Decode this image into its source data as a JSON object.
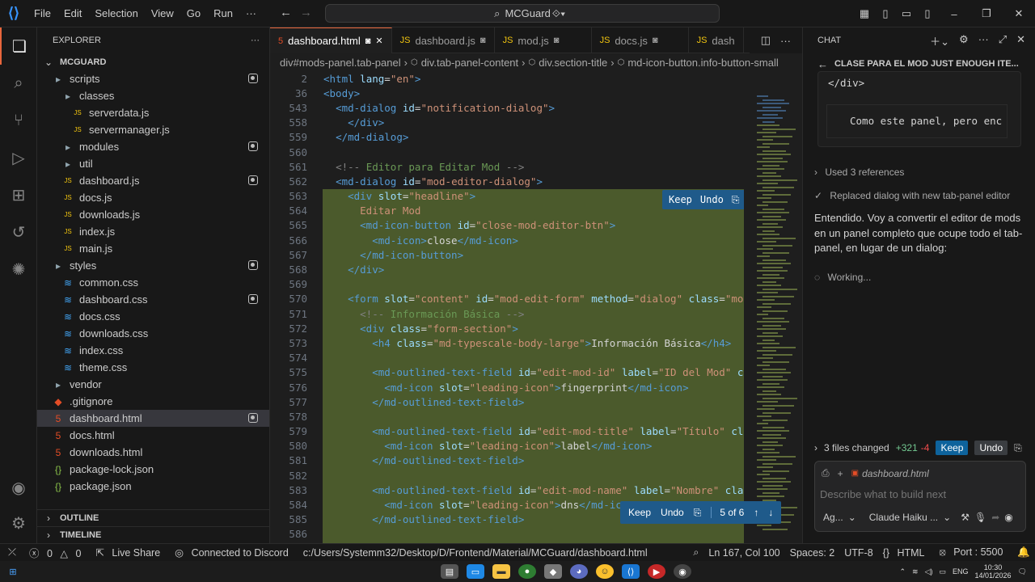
{
  "menu": [
    "File",
    "Edit",
    "Selection",
    "View",
    "Go",
    "Run",
    "···"
  ],
  "command_center": "MCGuard",
  "explorer": {
    "title": "EXPLORER",
    "root": "MCGUARD",
    "items": [
      {
        "name": "scripts",
        "kind": "folder",
        "depth": 1,
        "modified": true
      },
      {
        "name": "classes",
        "kind": "folder",
        "depth": 2,
        "modified": false
      },
      {
        "name": "serverdata.js",
        "kind": "js",
        "depth": 3,
        "modified": false
      },
      {
        "name": "servermanager.js",
        "kind": "js",
        "depth": 3,
        "modified": false
      },
      {
        "name": "modules",
        "kind": "folder",
        "depth": 2,
        "modified": true
      },
      {
        "name": "util",
        "kind": "folder",
        "depth": 2,
        "modified": false
      },
      {
        "name": "dashboard.js",
        "kind": "js",
        "depth": 2,
        "modified": true
      },
      {
        "name": "docs.js",
        "kind": "js",
        "depth": 2,
        "modified": false
      },
      {
        "name": "downloads.js",
        "kind": "js",
        "depth": 2,
        "modified": false
      },
      {
        "name": "index.js",
        "kind": "js",
        "depth": 2,
        "modified": false
      },
      {
        "name": "main.js",
        "kind": "js",
        "depth": 2,
        "modified": false
      },
      {
        "name": "styles",
        "kind": "folder",
        "depth": 1,
        "modified": true
      },
      {
        "name": "common.css",
        "kind": "css",
        "depth": 2,
        "modified": false
      },
      {
        "name": "dashboard.css",
        "kind": "css",
        "depth": 2,
        "modified": true
      },
      {
        "name": "docs.css",
        "kind": "css",
        "depth": 2,
        "modified": false
      },
      {
        "name": "downloads.css",
        "kind": "css",
        "depth": 2,
        "modified": false
      },
      {
        "name": "index.css",
        "kind": "css",
        "depth": 2,
        "modified": false
      },
      {
        "name": "theme.css",
        "kind": "css",
        "depth": 2,
        "modified": false
      },
      {
        "name": "vendor",
        "kind": "folder",
        "depth": 1,
        "modified": false
      },
      {
        "name": ".gitignore",
        "kind": "git",
        "depth": 1,
        "modified": false
      },
      {
        "name": "dashboard.html",
        "kind": "html",
        "depth": 1,
        "modified": true,
        "selected": true
      },
      {
        "name": "docs.html",
        "kind": "html",
        "depth": 1,
        "modified": false
      },
      {
        "name": "downloads.html",
        "kind": "html",
        "depth": 1,
        "modified": false
      },
      {
        "name": "package-lock.json",
        "kind": "json",
        "depth": 1,
        "modified": false
      },
      {
        "name": "package.json",
        "kind": "json",
        "depth": 1,
        "modified": false
      }
    ],
    "outline": "OUTLINE",
    "timeline": "TIMELINE"
  },
  "tabs": [
    {
      "label": "dashboard.html",
      "kind": "html",
      "active": true
    },
    {
      "label": "dashboard.js",
      "kind": "js",
      "active": false
    },
    {
      "label": "mod.js",
      "kind": "js",
      "active": false
    },
    {
      "label": "docs.js",
      "kind": "js",
      "active": false
    },
    {
      "label": "dash",
      "kind": "js",
      "active": false
    }
  ],
  "breadcrumbs": [
    "div#mods-panel.tab-panel",
    "div.tab-panel-content",
    "div.section-title",
    "md-icon-button.info-button-small"
  ],
  "code_lines": [
    {
      "n": "2",
      "h": "<span class=tg>&lt;html</span> <span class=at>lang</span>=<span class=st>\"en\"</span><span class=tg>&gt;</span>",
      "i": 0
    },
    {
      "n": "36",
      "h": "<span class=tg>&lt;body&gt;</span>",
      "i": 0
    },
    {
      "n": "543",
      "h": "  <span class=tg>&lt;md-dialog</span> <span class=at>id</span>=<span class=st>\"notification-dialog\"</span><span class=tg>&gt;</span>",
      "i": 0
    },
    {
      "n": "558",
      "h": "    <span class=tg>&lt;/div&gt;</span>",
      "i": 0
    },
    {
      "n": "559",
      "h": "  <span class=tg>&lt;/md-dialog&gt;</span>",
      "i": 0
    },
    {
      "n": "560",
      "h": "",
      "i": 1
    },
    {
      "n": "561",
      "h": "  <span class=tgy>&lt;!--</span> <span class=cm>Editor para Editar Mod</span> <span class=tgy>--&gt;</span>",
      "i": 1
    },
    {
      "n": "562",
      "h": "  <span class=tg>&lt;md-dialog</span> <span class=at>id</span>=<span class=st>\"mod-editor-dialog\"</span><span class=tg>&gt;</span>",
      "i": 1
    },
    {
      "n": "563",
      "h": "    <span class=tg>&lt;div</span> <span class=at>slot</span>=<span class=st>\"headline\"</span><span class=tg>&gt;</span>",
      "i": 1
    },
    {
      "n": "564",
      "h": "      <span class=st>Editar Mod</span>",
      "i": 1
    },
    {
      "n": "565",
      "h": "      <span class=tg>&lt;md-icon-button</span> <span class=at>id</span>=<span class=st>\"close-mod-editor-btn\"</span><span class=tg>&gt;</span>",
      "i": 1
    },
    {
      "n": "566",
      "h": "        <span class=tg>&lt;md-icon&gt;</span><span class=tx>close</span><span class=tg>&lt;/md-icon&gt;</span>",
      "i": 1
    },
    {
      "n": "567",
      "h": "      <span class=tg>&lt;/md-icon-button&gt;</span>",
      "i": 1
    },
    {
      "n": "568",
      "h": "    <span class=tg>&lt;/div&gt;</span>",
      "i": 1
    },
    {
      "n": "569",
      "h": "",
      "i": 1
    },
    {
      "n": "570",
      "h": "    <span class=tg>&lt;form</span> <span class=at>slot</span>=<span class=st>\"content\"</span> <span class=at>id</span>=<span class=st>\"mod-edit-form\"</span> <span class=at>method</span>=<span class=st>\"dialog\"</span> <span class=at>class</span>=<span class=st>\"mod-</span>",
      "i": 1
    },
    {
      "n": "571",
      "h": "      <span class=tgy>&lt;!--</span> <span class=cm>Información Básica</span> <span class=tgy>--&gt;</span>",
      "i": 1
    },
    {
      "n": "572",
      "h": "      <span class=tg>&lt;div</span> <span class=at>class</span>=<span class=st>\"form-section\"</span><span class=tg>&gt;</span>",
      "i": 1
    },
    {
      "n": "573",
      "h": "        <span class=tg>&lt;h4</span> <span class=at>class</span>=<span class=st>\"md-typescale-body-large\"</span><span class=tg>&gt;</span><span class=tx>Información Básica</span><span class=tg>&lt;/h4&gt;</span>",
      "i": 1
    },
    {
      "n": "574",
      "h": "",
      "i": 1
    },
    {
      "n": "575",
      "h": "        <span class=tg>&lt;md-outlined-text-field</span> <span class=at>id</span>=<span class=st>\"edit-mod-id\"</span> <span class=at>label</span>=<span class=st>\"ID del Mod\"</span> <span class=at>cla</span>",
      "i": 1
    },
    {
      "n": "576",
      "h": "          <span class=tg>&lt;md-icon</span> <span class=at>slot</span>=<span class=st>\"leading-icon\"</span><span class=tg>&gt;</span><span class=tx>fingerprint</span><span class=tg>&lt;/md-icon&gt;</span>",
      "i": 1
    },
    {
      "n": "577",
      "h": "        <span class=tg>&lt;/md-outlined-text-field&gt;</span>",
      "i": 1
    },
    {
      "n": "578",
      "h": "",
      "i": 1
    },
    {
      "n": "579",
      "h": "        <span class=tg>&lt;md-outlined-text-field</span> <span class=at>id</span>=<span class=st>\"edit-mod-title\"</span> <span class=at>label</span>=<span class=st>\"Título\"</span> <span class=at>clas</span>",
      "i": 1
    },
    {
      "n": "580",
      "h": "          <span class=tg>&lt;md-icon</span> <span class=at>slot</span>=<span class=st>\"leading-icon\"</span><span class=tg>&gt;</span><span class=tx>label</span><span class=tg>&lt;/md-icon&gt;</span>",
      "i": 1
    },
    {
      "n": "581",
      "h": "        <span class=tg>&lt;/md-outlined-text-field&gt;</span>",
      "i": 1
    },
    {
      "n": "582",
      "h": "",
      "i": 1
    },
    {
      "n": "583",
      "h": "        <span class=tg>&lt;md-outlined-text-field</span> <span class=at>id</span>=<span class=st>\"edit-mod-name\"</span> <span class=at>label</span>=<span class=st>\"Nombre\"</span> <span class=at>class</span>",
      "i": 1
    },
    {
      "n": "584",
      "h": "          <span class=tg>&lt;md-icon</span> <span class=at>slot</span>=<span class=st>\"leading-icon\"</span><span class=tg>&gt;</span><span class=tx>dns</span><span class=tg>&lt;/md-ico</span>",
      "i": 1
    },
    {
      "n": "585",
      "h": "        <span class=tg>&lt;/md-outlined-text-field&gt;</span>",
      "i": 1
    },
    {
      "n": "586",
      "h": "",
      "i": 1
    }
  ],
  "inline_actions": {
    "keep": "Keep",
    "undo": "Undo",
    "counter": "5 of 6"
  },
  "chat": {
    "header": "CHAT",
    "title": "CLASE PARA EL MOD JUST ENOUGH ITE...",
    "code_close_div": "</div>",
    "code_line": "Como este panel, pero enc",
    "used_refs": "Used 3 references",
    "replaced": "Replaced dialog with new tab-panel editor",
    "message": "Entendido. Voy a convertir el editor de mods en un panel completo que ocupe todo el tab-panel, en lugar de un dialog:",
    "working": "Working...",
    "files_changed": "3 files changed",
    "added": "+321",
    "removed": "-4",
    "attached_file": "dashboard.html",
    "placeholder": "Describe what to build next",
    "agent": "Ag...",
    "model": "Claude Haiku ..."
  },
  "status": {
    "errors": "0",
    "warnings": "0",
    "live_share": "Live Share",
    "discord": "Connected to Discord",
    "path": "c:/Users/Systemm32/Desktop/D/Frontend/Material/MCGuard/dashboard.html",
    "position": "Ln 167, Col 100",
    "spaces": "Spaces: 2",
    "encoding": "UTF-8",
    "language": "HTML",
    "port": "Port : 5500"
  },
  "taskbar": {
    "lang": "ENG",
    "time": "10:30",
    "date": "14/01/2026"
  },
  "colors": {
    "accent": "#e8663c",
    "added_bg": "#4b5a2c",
    "keep_btn": "#0e639c"
  }
}
